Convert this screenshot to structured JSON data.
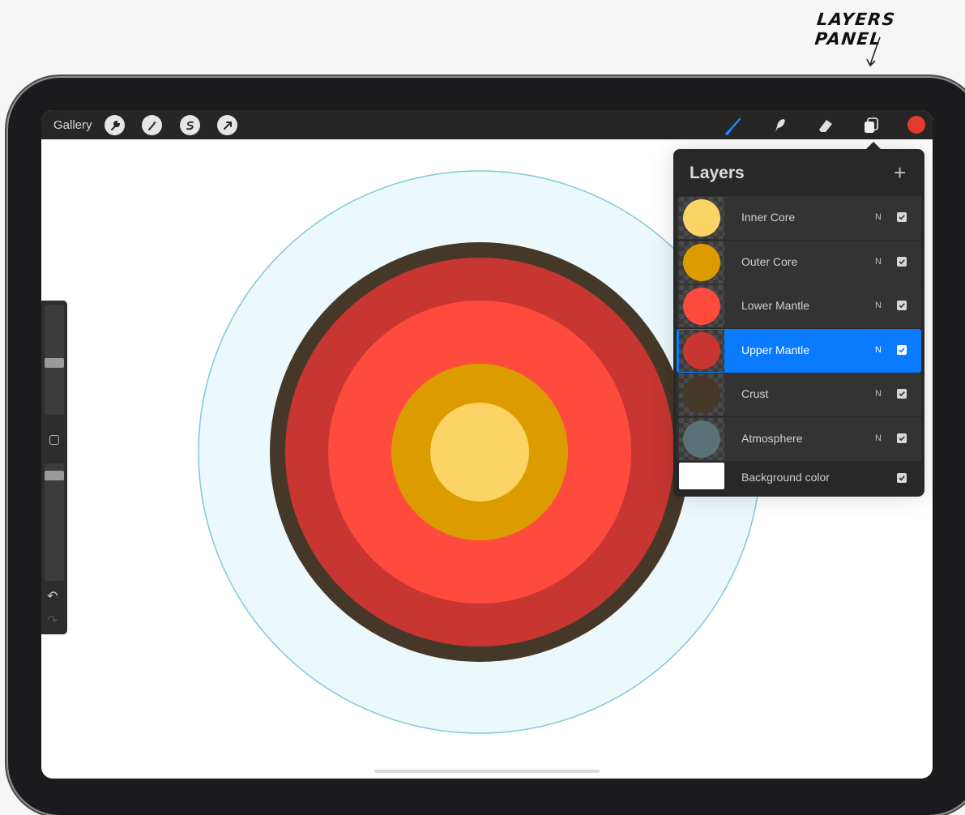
{
  "annotation": {
    "label": "LAYERS PANEL"
  },
  "toolbar": {
    "gallery_label": "Gallery",
    "left_tools": [
      "wrench-icon",
      "magic-wand-icon",
      "selection-icon",
      "transform-arrow-icon"
    ],
    "right_tools": [
      "brush-icon",
      "smudge-icon",
      "eraser-icon",
      "layers-icon"
    ],
    "active_tool": "brush-icon",
    "current_color": "#e33b2e"
  },
  "layers_panel": {
    "title": "Layers",
    "add_label": "+",
    "layers": [
      {
        "name": "Inner Core",
        "blend": "N",
        "visible": true,
        "color": "#fcd466",
        "selected": false
      },
      {
        "name": "Outer Core",
        "blend": "N",
        "visible": true,
        "color": "#dc9c00",
        "selected": false
      },
      {
        "name": "Lower Mantle",
        "blend": "N",
        "visible": true,
        "color": "#fe4b3e",
        "selected": false
      },
      {
        "name": "Upper Mantle",
        "blend": "N",
        "visible": true,
        "color": "#c73631",
        "selected": true
      },
      {
        "name": "Crust",
        "blend": "N",
        "visible": true,
        "color": "#463828",
        "selected": false
      },
      {
        "name": "Atmosphere",
        "blend": "N",
        "visible": true,
        "color": "#5a7177",
        "selected": false
      }
    ],
    "background": {
      "name": "Background color",
      "visible": true,
      "color": "#ffffff"
    }
  },
  "canvas": {
    "rings": [
      {
        "layer": "Atmosphere",
        "fill": "#ebf8fc",
        "stroke": "#7fc9d5"
      },
      {
        "layer": "Crust",
        "fill": "#463828"
      },
      {
        "layer": "Upper Mantle",
        "fill": "#c73631"
      },
      {
        "layer": "Lower Mantle",
        "fill": "#fe4b3e"
      },
      {
        "layer": "Outer Core",
        "fill": "#dc9c00"
      },
      {
        "layer": "Inner Core",
        "fill": "#fcd466"
      }
    ]
  },
  "sidebar": {
    "brush_size_level": 0.47,
    "opacity_level": 0.93,
    "undo_icon": "undo-icon",
    "redo_icon": "redo-icon"
  }
}
